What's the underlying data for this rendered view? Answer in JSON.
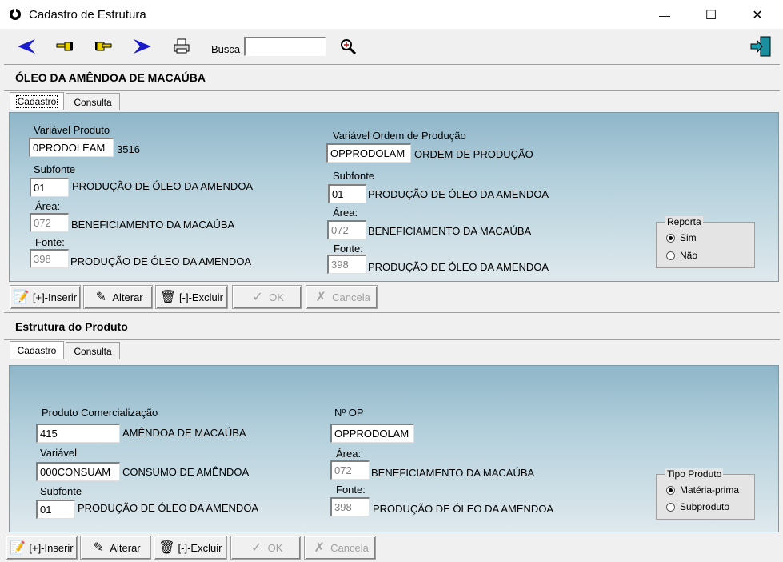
{
  "window": {
    "title": "Cadastro de Estrutura",
    "minimize": "—",
    "maximize": "☐",
    "close": "✕"
  },
  "toolbar": {
    "search_label": "Busca",
    "search_value": ""
  },
  "section1": {
    "title": "ÓLEO DA AMÊNDOA DE MACAÚBA",
    "tabs": [
      "Cadastro",
      "Consulta"
    ],
    "var_produto": {
      "label": "Variável Produto",
      "value": "0PRODOLEAM",
      "desc": "3516"
    },
    "subfonte": {
      "label": "Subfonte",
      "value": "01",
      "desc": "PRODUÇÃO DE ÓLEO DA AMENDOA"
    },
    "area": {
      "label": "Área:",
      "value": "072",
      "desc": "BENEFICIAMENTO DA MACAÚBA"
    },
    "fonte": {
      "label": "Fonte:",
      "value": "398",
      "desc": "PRODUÇÃO DE ÓLEO DA AMENDOA"
    },
    "var_ordem": {
      "label": "Variável Ordem de Produção",
      "value": "OPPRODOLAM",
      "desc": "ORDEM DE PRODUÇÃO"
    },
    "subfonte2": {
      "label": "Subfonte",
      "value": "01",
      "desc": "PRODUÇÃO DE ÓLEO DA AMENDOA"
    },
    "area2": {
      "label": "Área:",
      "value": "072",
      "desc": "BENEFICIAMENTO DA MACAÚBA"
    },
    "fonte2": {
      "label": "Fonte:",
      "value": "398",
      "desc": "PRODUÇÃO DE ÓLEO DA AMENDOA"
    },
    "reporta": {
      "label": "Reporta",
      "options": [
        "Sim",
        "Não"
      ],
      "selected": "Sim"
    }
  },
  "buttons": {
    "inserir": "[+]-Inserir",
    "alterar": "Alterar",
    "excluir": "[-]-Excluir",
    "ok": "OK",
    "cancela": "Cancela"
  },
  "section2": {
    "title": "Estrutura do Produto",
    "tabs": [
      "Cadastro",
      "Consulta"
    ],
    "produto_com": {
      "label": "Produto Comercialização",
      "value": "415",
      "desc": "AMÊNDOA DE MACAÚBA"
    },
    "variavel": {
      "label": "Variável",
      "value": "000CONSUAM",
      "desc": "CONSUMO DE AMÊNDOA"
    },
    "subfonte": {
      "label": "Subfonte",
      "value": "01",
      "desc": "PRODUÇÃO DE ÓLEO DA AMENDOA"
    },
    "nop": {
      "label": "Nº OP",
      "value": "OPPRODOLAM"
    },
    "area": {
      "label": "Área:",
      "value": "072",
      "desc": "BENEFICIAMENTO DA MACAÚBA"
    },
    "fonte": {
      "label": "Fonte:",
      "value": "398",
      "desc": "PRODUÇÃO DE ÓLEO DA AMENDOA"
    },
    "tipo": {
      "label": "Tipo Produto",
      "options": [
        "Matéria-prima",
        "Subproduto"
      ],
      "selected": "Matéria-prima"
    }
  },
  "colors": {
    "panel_top": "#8fb6c9",
    "panel_bottom": "#dfe9ed",
    "nav_arrow": "#1a1acc"
  },
  "icons": [
    "app-logo-icon",
    "back-arrow-icon",
    "prev-hand-icon",
    "next-hand-icon",
    "forward-arrow-icon",
    "print-icon",
    "search-icon",
    "exit-door-icon"
  ]
}
